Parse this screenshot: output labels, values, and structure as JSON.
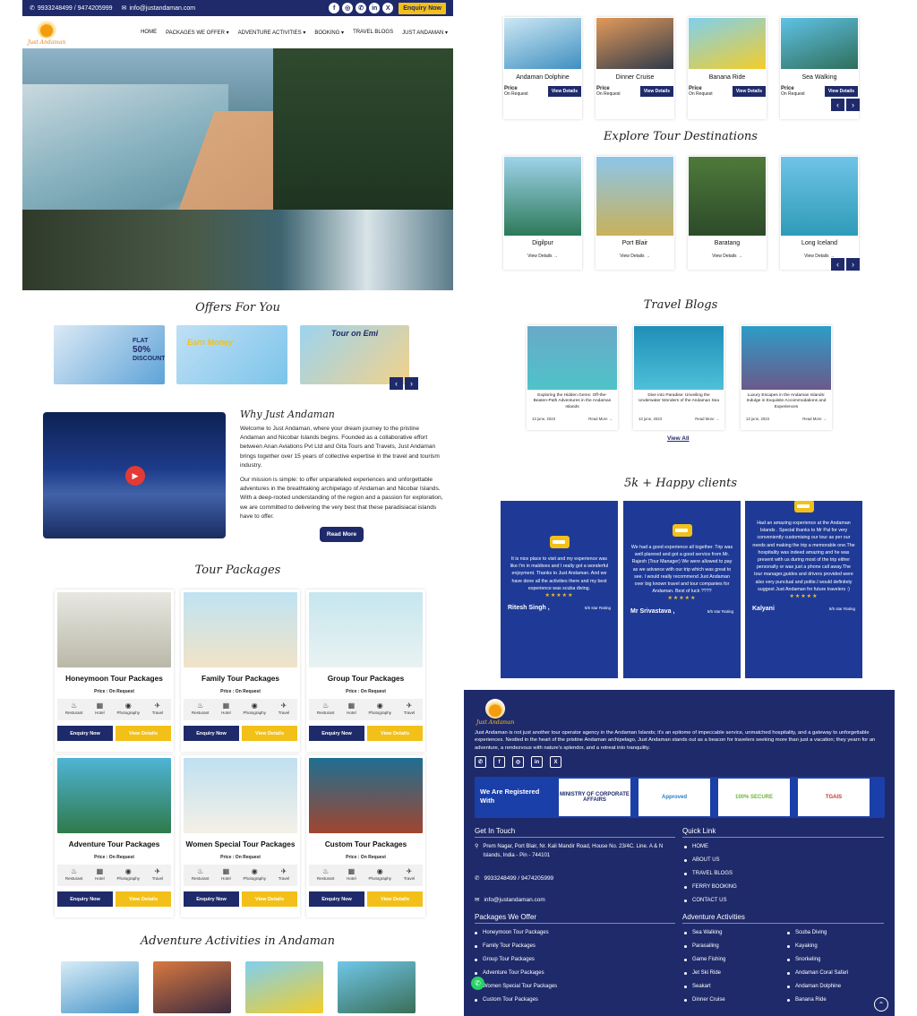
{
  "topbar": {
    "phone": "9933248499 / 9474205999",
    "email": "info@justandaman.com",
    "enquiry": "Enquiry Now"
  },
  "brand": {
    "logo_text": "Just Andaman"
  },
  "nav": {
    "home": "HOME",
    "packages": "PACKAGES WE OFFER ▾",
    "adventure": "ADVENTURE ACTIVITIES ▾",
    "booking": "BOOKING ▾",
    "blogs": "TRAVEL BLOGS",
    "just": "JUST ANDAMAN ▾"
  },
  "offers": {
    "title": "Offers For You",
    "o1": {
      "line1": "FLAT",
      "line2": "50%",
      "line3": "DISCOUNT"
    },
    "o2": {
      "line1": "Earn Money"
    },
    "o3": {
      "line1": "Tour on Emi"
    }
  },
  "why": {
    "title": "Why Just Andaman",
    "p1": "Welcome to Just Andaman, where your dream journey to the pristine Andaman and Nicobar Islands begins. Founded as a collaborative effort between Anan Aviations Pvt Ltd and Gita Tours and Travels, Just Andaman brings together over 15 years of collective expertise in the travel and tourism industry.",
    "p2": "Our mission is simple: to offer unparalleled experiences and unforgettable adventures in the breathtaking archipelago of Andaman and Nicobar Islands. With a deep-rooted understanding of the region and a passion for exploration, we are committed to delivering the very best that these paradisiacal islands have to offer.",
    "btn": "Read More"
  },
  "tour": {
    "title": "Tour Packages",
    "price": "Price : On Request",
    "features": [
      "Resturant",
      "Hotel",
      "Photography",
      "Travel"
    ],
    "enquiry": "Enquiry Now",
    "details": "View Details",
    "items": [
      "Honeymoon Tour Packages",
      "Family Tour Packages",
      "Group Tour Packages",
      "Adventure Tour Packages",
      "Women Special Tour Packages",
      "Custom Tour Packages"
    ]
  },
  "adventure": {
    "title": "Adventure Activities in Andaman",
    "items": [
      {
        "name": "Andaman Dolphine",
        "price": "Price",
        "sub": "On Request"
      },
      {
        "name": "Dinner Cruise",
        "price": "Price",
        "sub": "On Request"
      },
      {
        "name": "Banana Ride",
        "price": "Price",
        "sub": "On Request"
      },
      {
        "name": "Sea Walking",
        "price": "Price",
        "sub": "On Request"
      }
    ],
    "btn": "View Details"
  },
  "destinations": {
    "title": "Explore Tour Destinations",
    "items": [
      "Digilpur",
      "Port Blair",
      "Baratang",
      "Long Iceland"
    ],
    "link": "View Details →"
  },
  "blogs": {
    "title": "Travel Blogs",
    "view_all": "View All",
    "read": "Read More →",
    "items": [
      {
        "title": "Exploring the Hidden Gems: Off-the-Beaten-Path Adventures in the Andaman Islands",
        "date": "13 june, 2023"
      },
      {
        "title": "Dive into Paradise: Unveiling the Underwater Wonders of the Andaman Sea",
        "date": "13 june, 2023"
      },
      {
        "title": "Luxury Escapes in the Andaman Islands: Indulge in Exquisite Accommodations and Experiences",
        "date": "13 june, 2023"
      }
    ]
  },
  "clients": {
    "title": "5k + Happy clients",
    "items": [
      {
        "text": "It is nice place to visit and my experience was like I'm in maldives and I really got a wonderful enjoyment. Thanks to Just Andaman. And we have done all the activities there and my best experience was scuba diving.",
        "name": "Ritesh Singh ,",
        "rating": "5/5 star Rating"
      },
      {
        "text": "We had a good experience all together. Trip was well planned and got a good service from Mr. Rajesh (Tour Manager) We were allowed to pay as we advance with our trip which was great to see. I would really recommend Just Andaman over big known travel and tour companies for Andaman. Best of luck ????",
        "name": "Mr Srivastava ,",
        "rating": "5/5 star Rating"
      },
      {
        "text": "Had an amazing experience at the Andaman Islands . Special thanks to Mr Pal for very conveniently customising our tour as per our needs and making the trip a memorable one.The hospitality was indeed amazing and he was present with us during most of the trip either personally or was just a phone call away.The tour manager,guides and drivers provided were also very punctual and polite.I would definitely suggest Just Andaman for future travelers :)",
        "name": "Kalyani",
        "rating": "5/5 star Rating"
      }
    ],
    "stars": "★★★★★"
  },
  "footer": {
    "about": "Just Andaman is not just another tour operator agency in the Andaman Islands; it's an epitome of impeccable service, unmatched hospitality, and a gateway to unforgettable experiences. Nestled in the heart of the pristine Andaman archipelago, Just Andaman stands out as a beacon for travelers seeking more than just a vacation; they yearn for an adventure, a rendezvous with nature's splendor, and a retreat into tranquility.",
    "registered": "We Are Registered With",
    "badge1": "MINISTRY OF CORPORATE AFFAIRS",
    "badge2": "Approved",
    "badge3": "100% SECURE",
    "badge4": "TGAIS",
    "get_in_touch": "Get In Touch",
    "address": "Prem Nagar, Port Blair, Nr. Kali Mandir Road, House No. 23/4C. Line. A & N Islands, India - Pin - 744101",
    "phone": "9933248499 / 9474205999",
    "email": "info@justandaman.com",
    "quick_link": "Quick Link",
    "quick": [
      "HOME",
      "ABOUT US",
      "TRAVEL BLOGS",
      "FERRY BOOKING",
      "CONTACT US"
    ],
    "packages_title": "Packages We Offer",
    "packages": [
      "Honeymoon Tour Packages",
      "Family Tour Packages",
      "Group Tour Packages",
      "Adventure Tour Packages",
      "Women Special Tour Packages",
      "Custom Tour Packages"
    ],
    "adv_title": "Adventure Activities",
    "adv1": [
      "Sea Walking",
      "Parasailing",
      "Game Fishing",
      "Jet Ski Ride",
      "Seakart",
      "Dinner Cruise"
    ],
    "adv2": [
      "Scuba Diving",
      "Kayaking",
      "Snorkeling",
      "Andaman Coral Safari",
      "Andaman Dolphine",
      "Banana Ride"
    ]
  },
  "colors": {
    "navy": "#1f2a6b",
    "yellow": "#f2c019",
    "review_blue": "#1f3a96"
  }
}
